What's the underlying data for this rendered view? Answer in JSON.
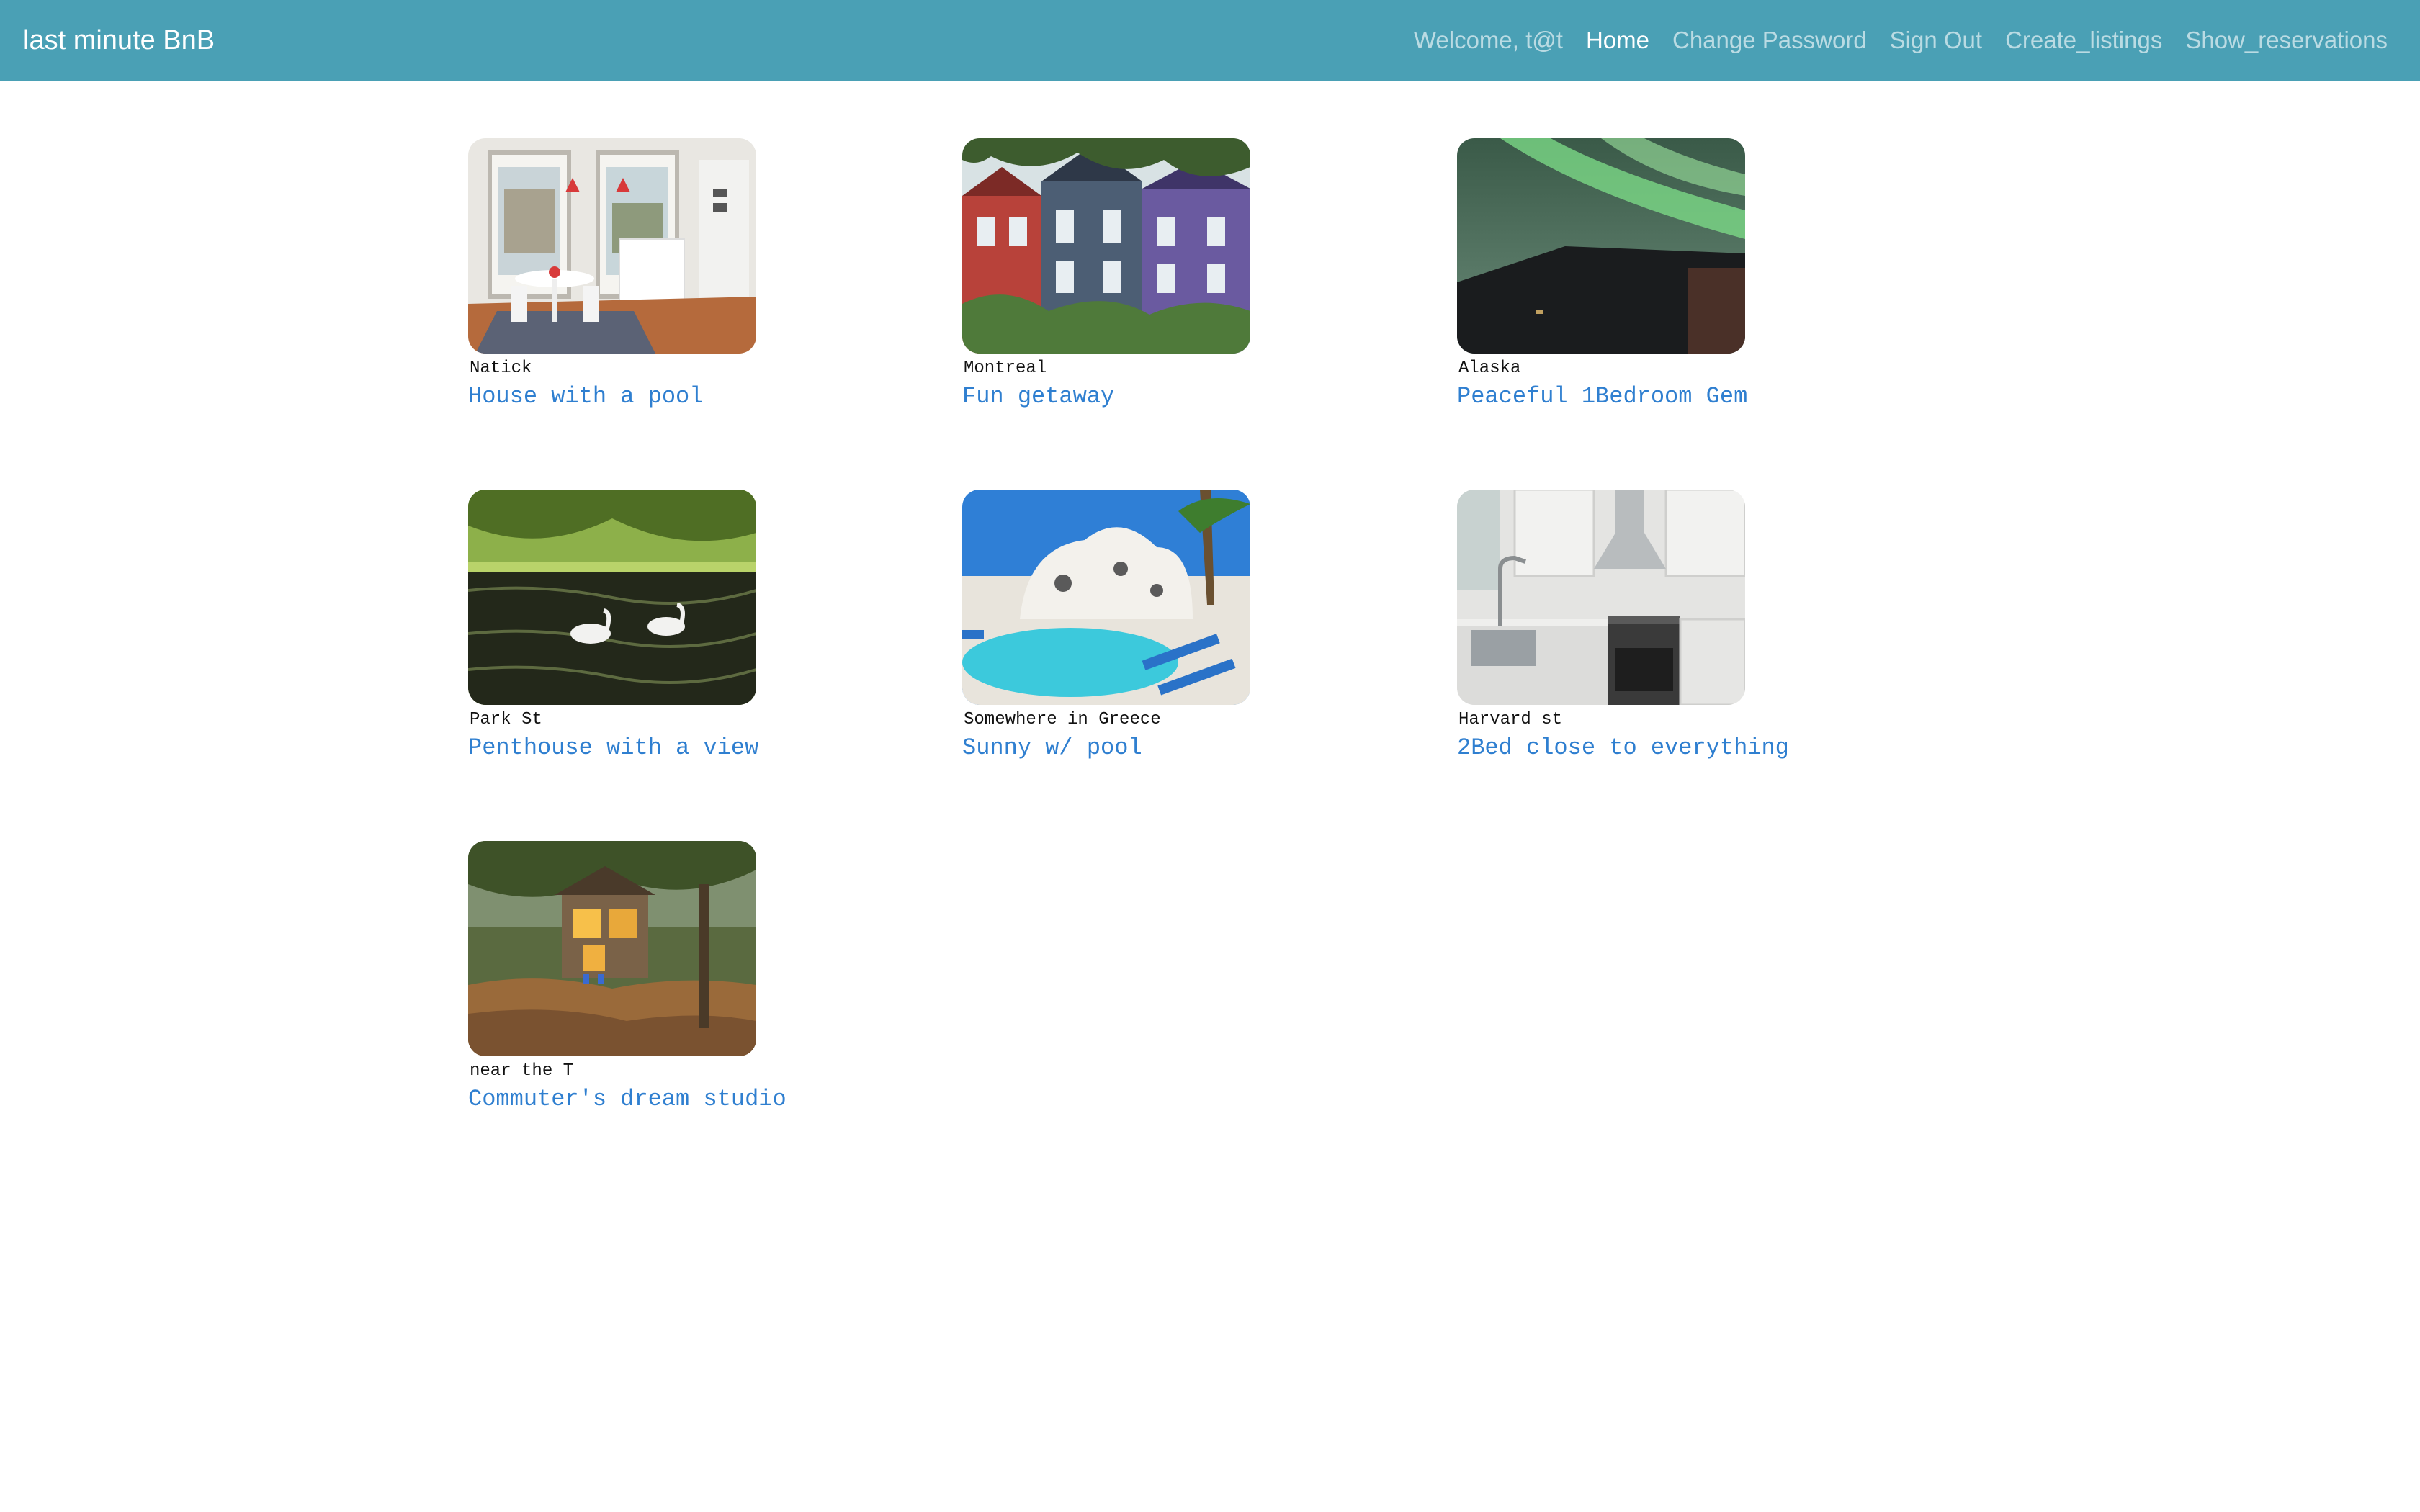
{
  "navbar": {
    "brand": "last minute BnB",
    "welcome": "Welcome, t@t",
    "links": [
      "Home",
      "Change Password",
      "Sign Out",
      "Create_listings",
      "Show_reservations"
    ]
  },
  "listings": [
    {
      "location": "Natick",
      "title": "House with a pool",
      "image": "kitchen-dining-photo"
    },
    {
      "location": "Montreal",
      "title": "Fun getaway",
      "image": "victorian-houses-photo"
    },
    {
      "location": "Alaska",
      "title": "Peaceful 1Bedroom Gem",
      "image": "northern-lights-photo"
    },
    {
      "location": "Park St",
      "title": "Penthouse with a view",
      "image": "swans-pond-photo"
    },
    {
      "location": "Somewhere in Greece",
      "title": "Sunny w/ pool",
      "image": "pool-villa-photo"
    },
    {
      "location": "Harvard st",
      "title": "2Bed close to everything",
      "image": "modern-kitchen-photo"
    },
    {
      "location": "near the T",
      "title": "Commuter's dream studio",
      "image": "treehouse-photo"
    }
  ]
}
